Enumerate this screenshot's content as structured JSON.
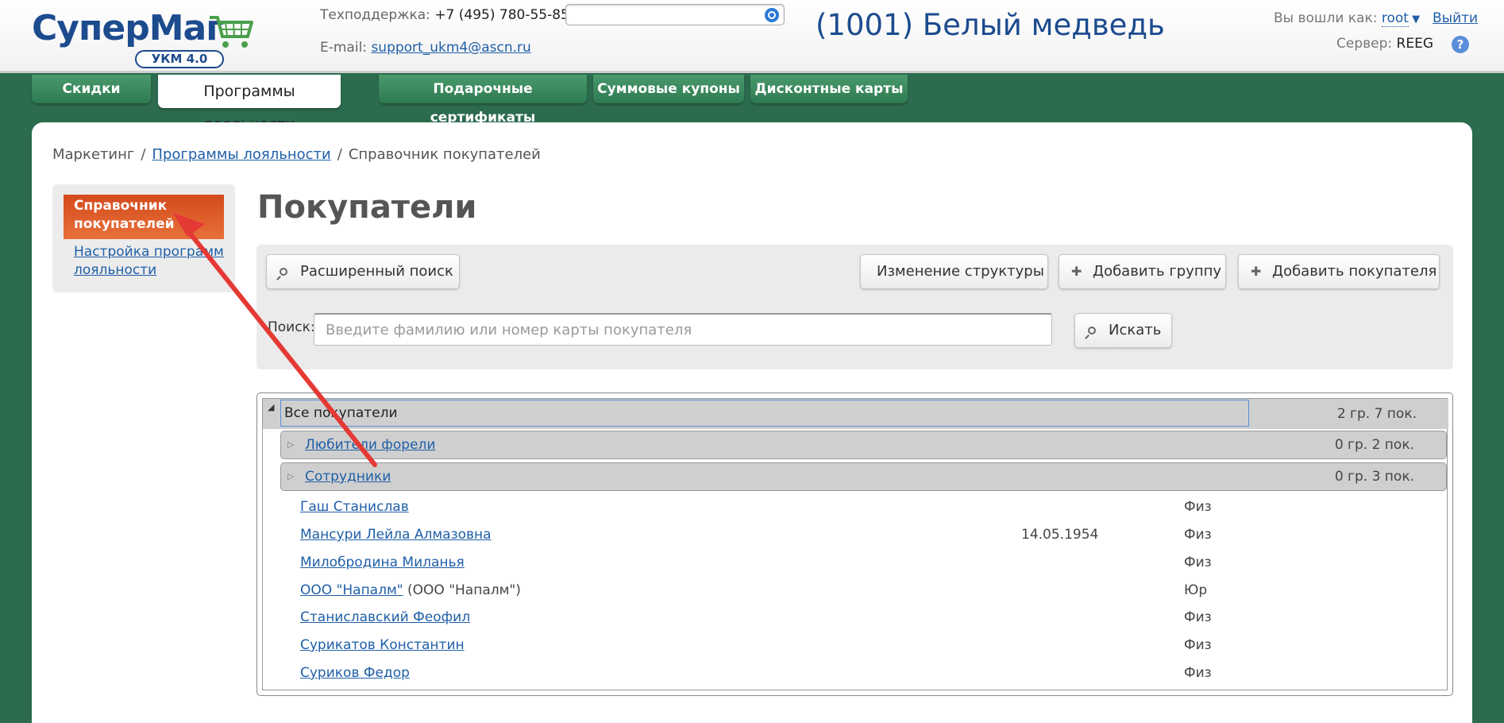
{
  "header": {
    "logo_text": "СуперМаг",
    "logo_badge": "УКМ 4.0",
    "support_label": "Техподдержка:",
    "support_phone": "+7 (495) 780-55-85",
    "email_label": "E-mail:",
    "email": "support_ukm4@ascn.ru",
    "search_placeholder": "",
    "store_title": "(1001) Белый медведь",
    "logged_in_label": "Вы вошли как:",
    "user": "root",
    "logout": "Выйти",
    "server_label": "Сервер:",
    "server": "REEG",
    "help": "?"
  },
  "tabs": [
    {
      "label": "Скидки"
    },
    {
      "label": "Программы лояльности"
    },
    {
      "label": "Подарочные сертификаты"
    },
    {
      "label": "Суммовые купоны"
    },
    {
      "label": "Дисконтные карты"
    }
  ],
  "breadcrumb": {
    "root": "Маркетинг",
    "sep1": "/",
    "link": "Программы лояльности",
    "sep2": "/",
    "current": "Справочник покупателей"
  },
  "sidebar": {
    "active": "Справочник покупателей",
    "link": "Настройка программ лояльности"
  },
  "page_title": "Покупатели",
  "toolbar": {
    "advanced_search": "Расширенный поиск",
    "change_structure": "Изменение структуры",
    "add_group": "Добавить группу",
    "add_customer": "Добавить покупателя",
    "search_label": "Поиск:",
    "search_placeholder": "Введите фамилию или номер карты покупателя",
    "search_button": "Искать"
  },
  "tree": {
    "root": {
      "name": "Все покупатели",
      "count": "2 гр. 7 пок."
    },
    "groups": [
      {
        "name": "Любители форели",
        "count": "0 гр. 2 пок."
      },
      {
        "name": "Сотрудники",
        "count": "0 гр. 3 пок."
      }
    ],
    "customers": [
      {
        "name": "Гаш Станислав",
        "extra": "",
        "date": "",
        "type": "Физ"
      },
      {
        "name": "Мансури Лейла Алмазовна",
        "extra": "",
        "date": "14.05.1954",
        "type": "Физ"
      },
      {
        "name": "Милобродина Миланья",
        "extra": "",
        "date": "",
        "type": "Физ"
      },
      {
        "name": "ООО \"Напалм\"",
        "extra": "(ООО \"Напалм\")",
        "date": "",
        "type": "Юр"
      },
      {
        "name": "Станиславский Феофил",
        "extra": "",
        "date": "",
        "type": "Физ"
      },
      {
        "name": "Сурикатов Константин",
        "extra": "",
        "date": "",
        "type": "Физ"
      },
      {
        "name": "Суриков Федор",
        "extra": "",
        "date": "",
        "type": "Физ"
      }
    ]
  },
  "colors": {
    "background": "#2c6b4e",
    "tab_green": "#3a8a5e",
    "accent_orange": "#d44a1c",
    "link_blue": "#1f5fa8",
    "annotation_red": "#e53935"
  }
}
